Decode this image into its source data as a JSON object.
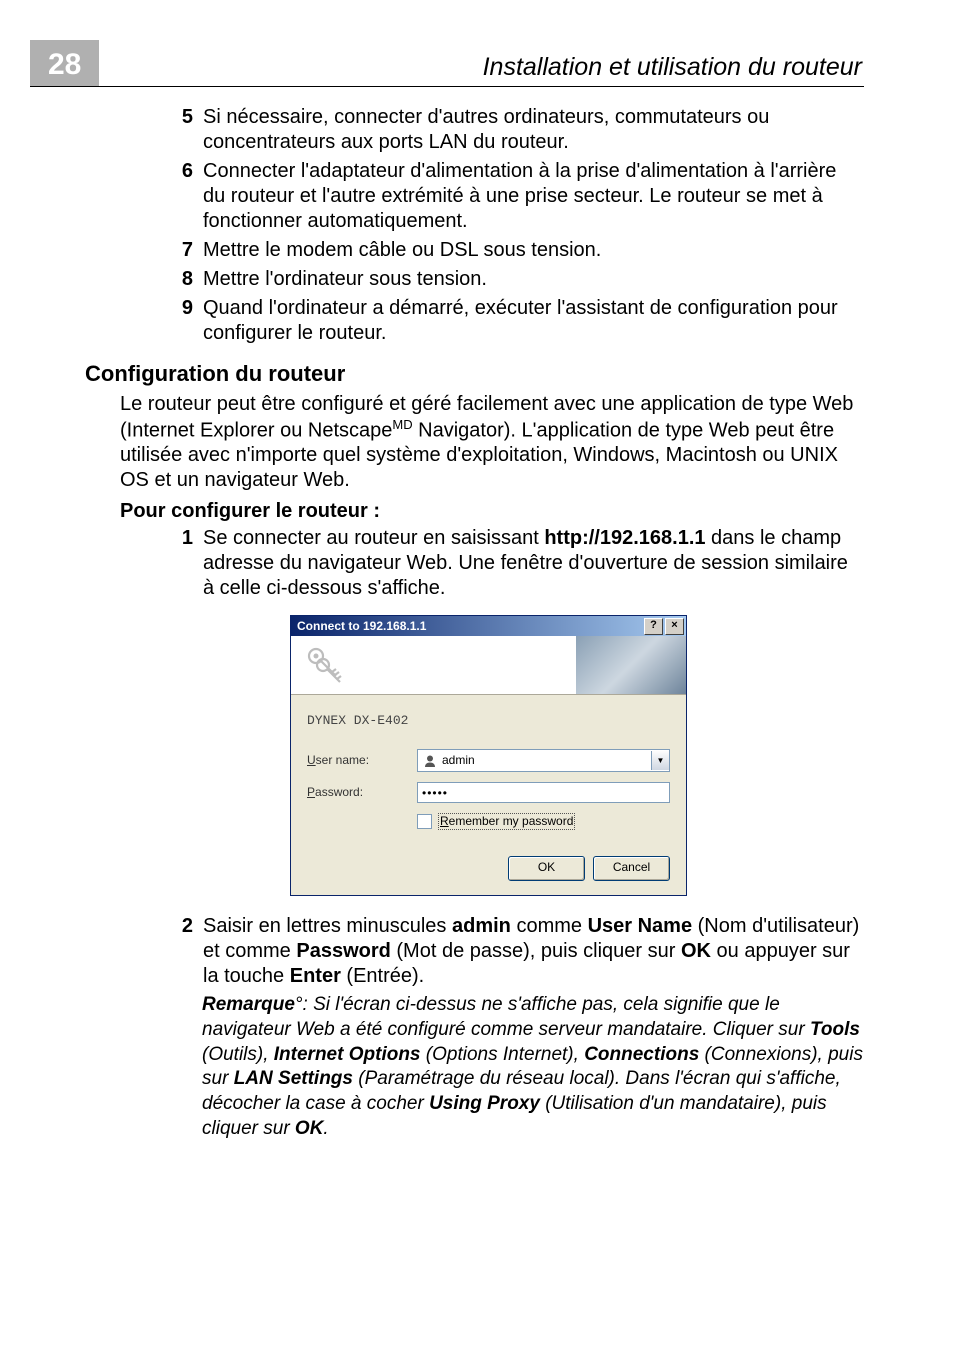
{
  "header": {
    "page_number": "28",
    "title": "Installation et utilisation du routeur"
  },
  "steps_a": [
    {
      "num": "5",
      "text": "Si nécessaire, connecter d'autres ordinateurs, commutateurs ou concentrateurs aux ports LAN du routeur."
    },
    {
      "num": "6",
      "text": "Connecter l'adaptateur d'alimentation à la prise d'alimentation à l'arrière du routeur et l'autre extrémité à une prise secteur. Le routeur se met à fonctionner automatiquement."
    },
    {
      "num": "7",
      "text": "Mettre le modem câble ou DSL sous tension."
    },
    {
      "num": "8",
      "text": "Mettre l'ordinateur sous tension."
    },
    {
      "num": "9",
      "text": "Quand l'ordinateur a démarré, exécuter l'assistant de configuration pour configurer le routeur."
    }
  ],
  "section_title": "Configuration du routeur",
  "intro": {
    "prefix": "Le routeur peut être configuré et géré facilement avec une application de type Web (Internet Explorer ou Netscape",
    "sup": "MD",
    "suffix": " Navigator). L'application de type Web peut être utilisée avec n'importe quel système d'exploitation, Windows, Macintosh ou UNIX OS et un navigateur Web."
  },
  "sub_title": "Pour configurer le routeur :",
  "step1": {
    "num": "1",
    "prefix": "Se connecter au routeur en saisissant ",
    "bold": "http://192.168.1.1",
    "suffix": " dans le champ adresse du navigateur Web. Une fenêtre d'ouverture de session similaire à celle ci-dessous s'affiche."
  },
  "dialog": {
    "title": "Connect to 192.168.1.1",
    "help_btn": "?",
    "close_btn": "×",
    "realm": "DYNEX DX-E402",
    "username_label_u": "U",
    "username_label_rest": "ser name:",
    "username_value": "admin",
    "password_label_u": "P",
    "password_label_rest": "assword:",
    "password_value": "•••••",
    "remember_u": "R",
    "remember_rest": "emember my password",
    "ok": "OK",
    "cancel": "Cancel"
  },
  "step2": {
    "num": "2",
    "t1": "Saisir en lettres minuscules ",
    "b1": "admin",
    "t2": " comme ",
    "b2": "User Name",
    "t3": " (Nom d'utilisateur) et comme ",
    "b3": "Password",
    "t4": " (Mot de passe), puis cliquer sur ",
    "b4": "OK",
    "t5": " ou appuyer sur la touche ",
    "b5": "Enter",
    "t6": " (Entrée)."
  },
  "remark": {
    "lead": "Remarque",
    "deg": "°",
    "t1": ": Si l'écran ci-dessus ne s'affiche pas, cela signifie que le navigateur Web a été configuré comme serveur mandataire. Cliquer sur ",
    "b1": "Tools",
    "t2": " (Outils), ",
    "b2": "Internet Options",
    "t3": " (Options Internet), ",
    "b3": "Connections",
    "t4": " (Connexions), puis sur ",
    "b4": "LAN Settings",
    "t5": " (Paramétrage du réseau local). Dans l'écran qui s'affiche, décocher la case à cocher ",
    "b5": "Using Proxy",
    "t6": " (Utilisation d'un mandataire), puis cliquer sur ",
    "b6": "OK",
    "t7": "."
  }
}
